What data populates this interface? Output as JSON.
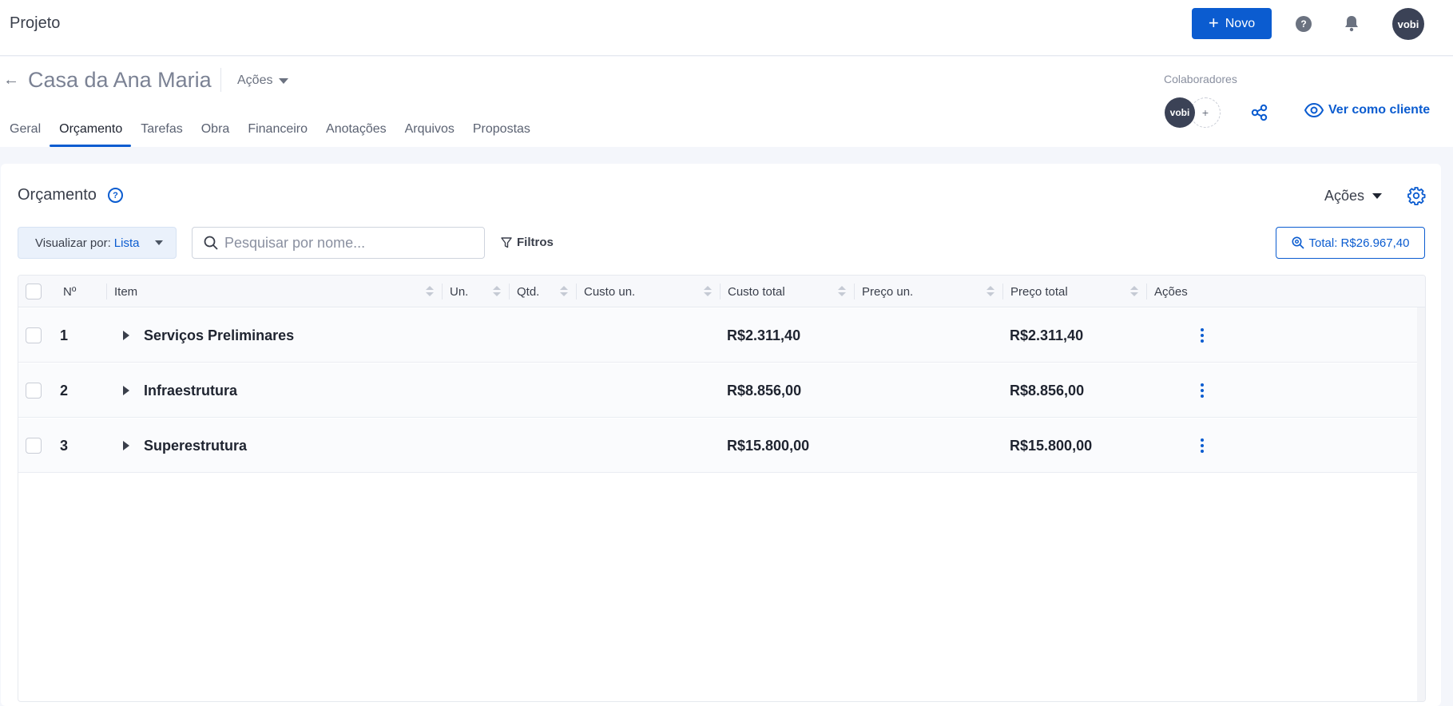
{
  "topbar": {
    "title": "Projeto",
    "new_button": "Novo",
    "help_icon": "question-circle-icon",
    "bell_icon": "bell-icon",
    "avatar_text": "vobi"
  },
  "project": {
    "back_icon": "arrow-left-icon",
    "name": "Casa da Ana Maria",
    "actions_label": "Ações",
    "collaborators_label": "Colaboradores",
    "collaborator_avatar": "vobi",
    "add_collaborator": "+",
    "share_icon": "share-icon",
    "view_as_client": "Ver como cliente",
    "tabs": [
      {
        "label": "Geral"
      },
      {
        "label": "Orçamento"
      },
      {
        "label": "Tarefas"
      },
      {
        "label": "Obra"
      },
      {
        "label": "Financeiro"
      },
      {
        "label": "Anotações"
      },
      {
        "label": "Arquivos"
      },
      {
        "label": "Propostas"
      }
    ],
    "active_tab": "Orçamento"
  },
  "budget": {
    "title": "Orçamento",
    "actions_label": "Ações",
    "view_by_label": "Visualizar por:",
    "view_by_value": "Lista",
    "search_placeholder": "Pesquisar por nome...",
    "filters_label": "Filtros",
    "total_label": "Total: R$26.967,40",
    "columns": [
      "Nº",
      "Item",
      "Un.",
      "Qtd.",
      "Custo un.",
      "Custo total",
      "Preço un.",
      "Preço total",
      "Ações"
    ],
    "rows": [
      {
        "num": "1",
        "name": "Serviços Preliminares",
        "custo_total": "R$2.311,40",
        "preco_total": "R$2.311,40"
      },
      {
        "num": "2",
        "name": "Infraestrutura",
        "custo_total": "R$8.856,00",
        "preco_total": "R$8.856,00"
      },
      {
        "num": "3",
        "name": "Superestrutura",
        "custo_total": "R$15.800,00",
        "preco_total": "R$15.800,00"
      }
    ]
  },
  "colors": {
    "primary": "#0b5cd0",
    "avatar_bg": "#3b4256",
    "page_bg": "#f4f6fb"
  }
}
